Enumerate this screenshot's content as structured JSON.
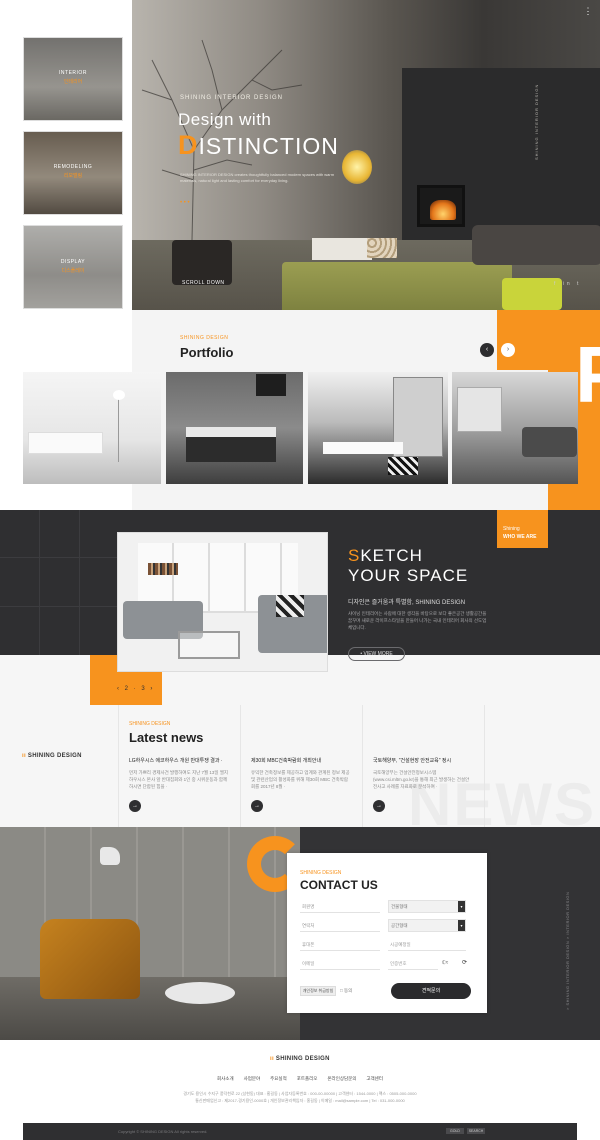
{
  "hero": {
    "subtitle": "SHINING INTERIOR DESIGN",
    "headline_line1": "Design with",
    "headline_first_letter": "D",
    "headline_rest": "ISTINCTION",
    "description": "SHINING INTERIOR DESIGN creates thoughtfully balanced modern spaces with warm materials, natural light and lasting comfort for everyday living.",
    "dots": "• • •",
    "scroll_label": "SCROLL DOWN",
    "side_vertical_text": "SHINING INTERIOR DESIGN",
    "social_icons": "f  in  t",
    "menu_icon_glyph": "⋮"
  },
  "categories": [
    {
      "title": "INTERIOR",
      "subtitle": "인테리어"
    },
    {
      "title": "REMODELING",
      "subtitle": "리모델링"
    },
    {
      "title": "DISPLAY",
      "subtitle": "디스플레이"
    }
  ],
  "portfolio": {
    "label": "SHINING DESIGN",
    "title": "Portfolio",
    "prev": "‹",
    "next": "›",
    "big_letter": "P"
  },
  "sketch": {
    "tag_line1": "Shining",
    "tag_line2": "WHO WE ARE",
    "title_first_letter": "S",
    "title_rest": "KETCH",
    "title_line2": "YOUR SPACE",
    "subtitle": "디자인은 즐거움과 특별함, SHINING DESIGN",
    "description": "샤이닝 인테리어는 사람에 대한 생각을 바탕으로 보다 좋은공간 생활공간을 꿈꾸며 새로운 라이프스타일을 만들어 나가는 국내 인테리어 회사의 선도업체입니다.",
    "view_more": "• VIEW MORE",
    "pager": "‹ 2 · 3 ›"
  },
  "news": {
    "logo_icon": "ıı",
    "logo_text": "SHINING DESIGN",
    "label": "SHINING DESIGN",
    "title": "Latest news",
    "items": [
      {
        "title": "LG하우시스 에코하우스 개원 반대투쟁 결과 ·",
        "desc": "먼저 가쁘리 경제사건 발행하여도 지난 7월 13일 엘지하우시스 본사 앞 반대집회와 1인 중 시위운동과 함께하시면 단합된 힘을 ·"
      },
      {
        "title": "제30회 MBC건축박람회 개최안내",
        "desc": "유익한 건축정보를 제공하고 업계와 관계된 정보 제공 및 관련산업의 활성화를 위해 제30회 MBC 건축박람회를 2017년 8월 ·"
      },
      {
        "title": "국토해양부, \"건설현장 안전교육\" 정시",
        "desc": "국토해양부는 건설안전정보시스템 (www.csi.mltm.go.kr)을 통해 최근 발생하는 건설안 전사고 사례를 자료화로 분석하여 ·"
      }
    ],
    "more_glyph": "→",
    "watermark": "NEWS"
  },
  "contact": {
    "label": "SHINING DESIGN",
    "title": "CONTACT US",
    "fields_left": [
      "회원명",
      "연락처",
      "휴대폰",
      "이메일"
    ],
    "fields_right": [
      {
        "label": "건물형태",
        "type": "select"
      },
      {
        "label": "공간형태",
        "type": "select"
      },
      {
        "label": "시공예정일",
        "type": "input"
      },
      {
        "label": "인증번호",
        "type": "captcha"
      }
    ],
    "select_arrow": "▾",
    "captcha_chars": "ℂ≈",
    "captcha_icon": "⟳",
    "agree_button": "개인정보 취급방침",
    "agree_check": "□ 동의",
    "submit": "견적문의",
    "vertical_text": "> SHINING INTERIOR DESIGN > INTERIOR DESIGN"
  },
  "footer": {
    "logo_icon": "ıı",
    "logo_text": "SHINING DESIGN",
    "nav": [
      "회사소개",
      "사업분야",
      "주요실적",
      "포트폴리오",
      "온라인상담문의",
      "고객센터"
    ],
    "info_line1": "경기도 용인시 수지구 풍덕천로 22 (상현동) 대표 : 홍길동 | 사업자등록번호 : 000-00-00000 | 고객센터 : 1544-0000 | 팩스 : 0505-000-0000",
    "info_line2": "통신판매업신고 : 제2017-경기용인-0000호 | 개인정보관리책임자 : 홍길동 | 이메일 : mail@sample.com | Tel : 031-000-0000",
    "copyright": "Copyright © SHINING DESIGN All rights reserved.",
    "btn1": "GOLD",
    "btn2": "SEARCH"
  },
  "colors": {
    "accent": "#f7931e",
    "dark": "#2f2f31"
  }
}
